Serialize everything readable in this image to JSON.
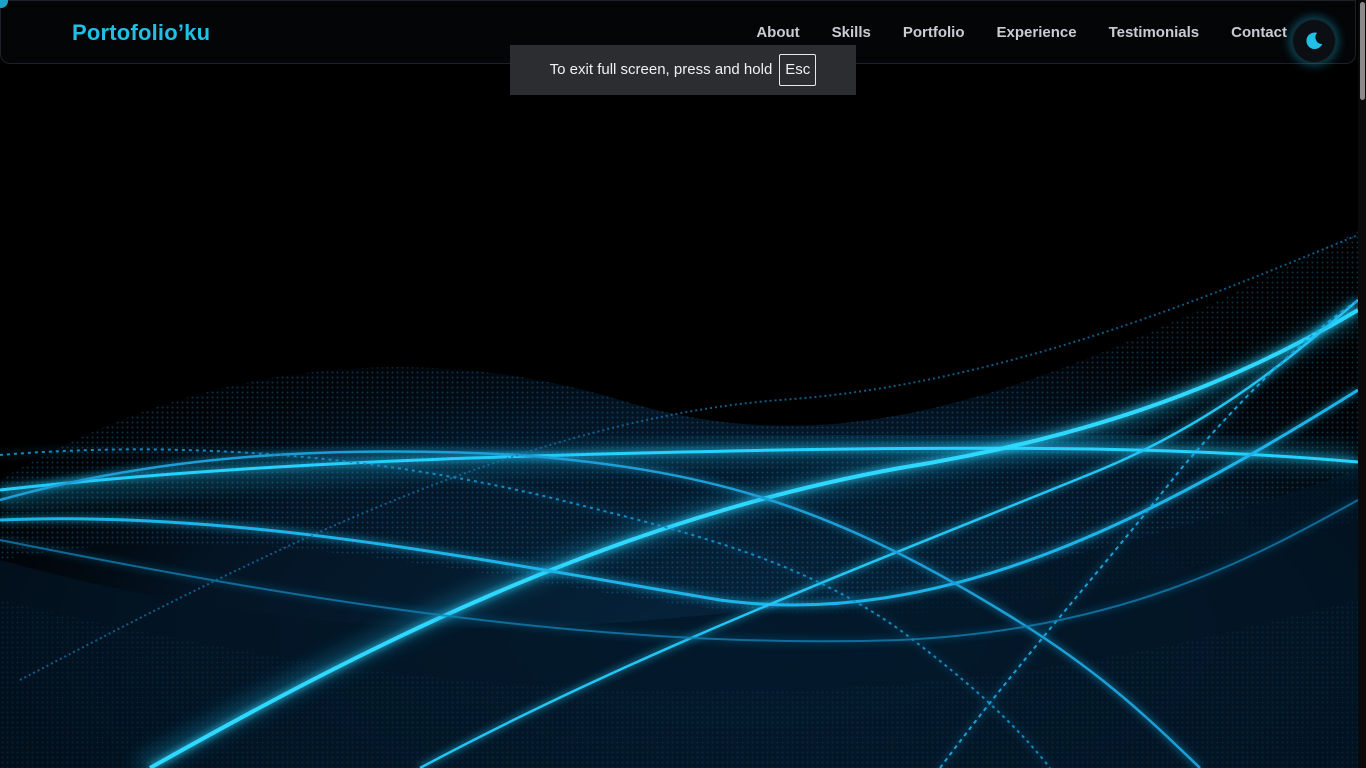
{
  "site": {
    "brand": "Portofolio’ku"
  },
  "nav": {
    "items": [
      {
        "label": "About"
      },
      {
        "label": "Skills"
      },
      {
        "label": "Portfolio"
      },
      {
        "label": "Experience"
      },
      {
        "label": "Testimonials"
      },
      {
        "label": "Contact"
      }
    ]
  },
  "theme_toggle": {
    "icon": "moon-icon",
    "accent_color": "#22bfe4"
  },
  "fullscreen_notice": {
    "text": "To exit full screen, press and hold",
    "key": "Esc"
  },
  "colors": {
    "brand": "#22bfe4",
    "background": "#000000",
    "wave": "#1ec8ff"
  }
}
